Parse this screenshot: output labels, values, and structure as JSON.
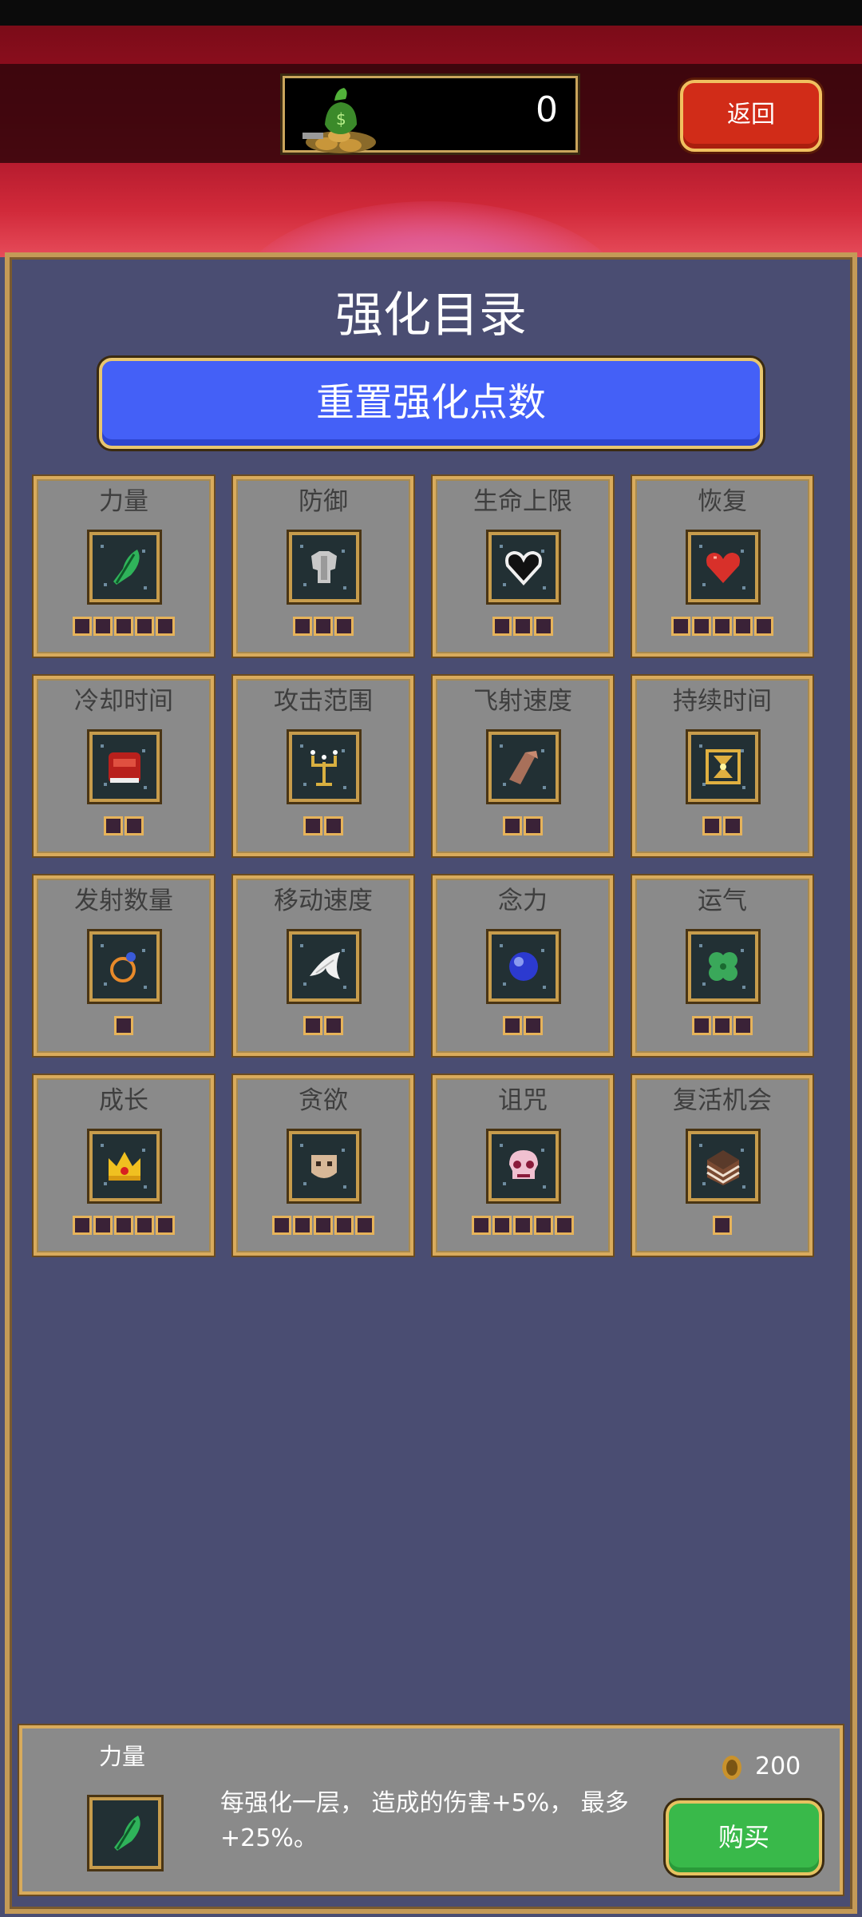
{
  "header": {
    "coin_count": "0",
    "back_label": "返回",
    "coin_bag_icon": "money-bag-icon"
  },
  "panel": {
    "title": "强化目录",
    "reset_label": "重置强化点数"
  },
  "upgrades": [
    {
      "label": "力量",
      "icon": "feather-icon",
      "pips": 5
    },
    {
      "label": "防御",
      "icon": "armor-icon",
      "pips": 3
    },
    {
      "label": "生命上限",
      "icon": "heart-outline-icon",
      "pips": 3
    },
    {
      "label": "恢复",
      "icon": "heart-icon",
      "pips": 5
    },
    {
      "label": "冷却时间",
      "icon": "tome-icon",
      "pips": 2
    },
    {
      "label": "攻击范围",
      "icon": "candelabra-icon",
      "pips": 2
    },
    {
      "label": "飞射速度",
      "icon": "gauntlet-icon",
      "pips": 2
    },
    {
      "label": "持续时间",
      "icon": "hourglass-icon",
      "pips": 2
    },
    {
      "label": "发射数量",
      "icon": "ring-icon",
      "pips": 1
    },
    {
      "label": "移动速度",
      "icon": "wing-icon",
      "pips": 2
    },
    {
      "label": "念力",
      "icon": "orb-icon",
      "pips": 2
    },
    {
      "label": "运气",
      "icon": "clover-icon",
      "pips": 3
    },
    {
      "label": "成长",
      "icon": "crown-icon",
      "pips": 5
    },
    {
      "label": "贪欲",
      "icon": "mask-icon",
      "pips": 5
    },
    {
      "label": "诅咒",
      "icon": "skull-icon",
      "pips": 5
    },
    {
      "label": "复活机会",
      "icon": "cake-icon",
      "pips": 1
    }
  ],
  "selected": {
    "name": "力量",
    "icon": "feather-icon",
    "description": "每强化一层， 造成的伤害+5%， 最多+25%。",
    "price": "200",
    "buy_label": "购买"
  }
}
